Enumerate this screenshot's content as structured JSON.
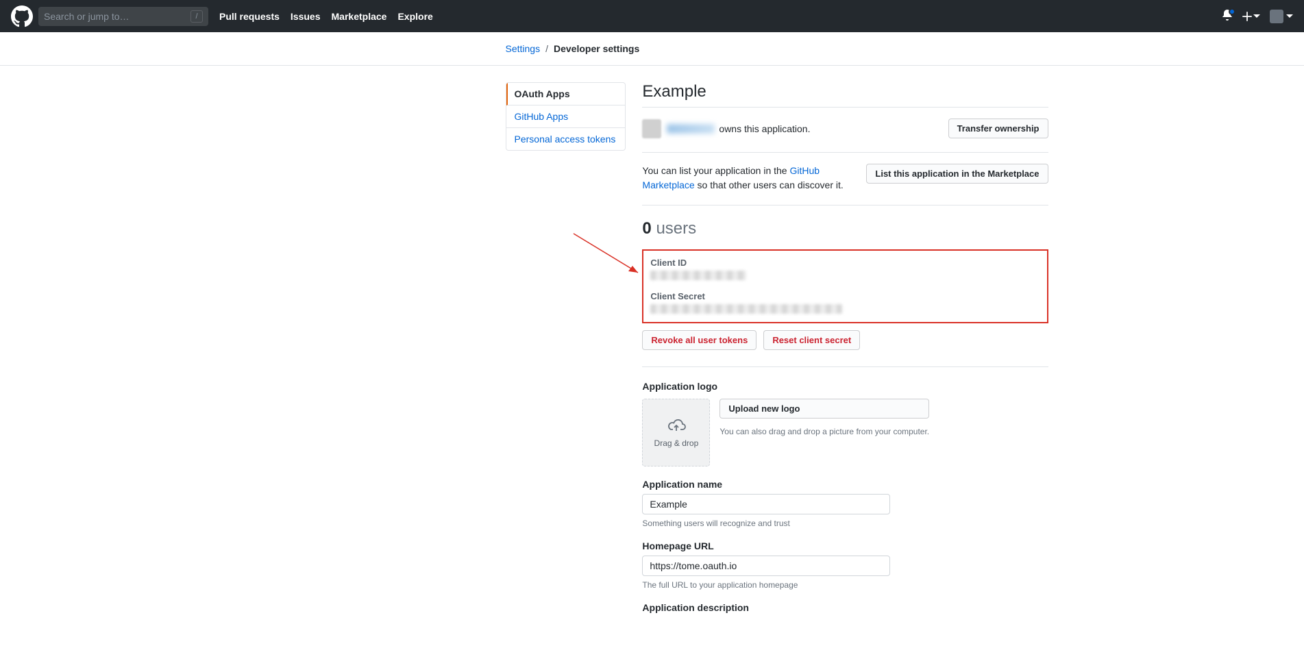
{
  "header": {
    "search_placeholder": "Search or jump to…",
    "slash_key": "/",
    "nav": {
      "pull_requests": "Pull requests",
      "issues": "Issues",
      "marketplace": "Marketplace",
      "explore": "Explore"
    }
  },
  "breadcrumb": {
    "settings": "Settings",
    "sep": "/",
    "current": "Developer settings"
  },
  "sidebar": {
    "items": [
      {
        "label": "OAuth Apps"
      },
      {
        "label": "GitHub Apps"
      },
      {
        "label": "Personal access tokens"
      }
    ]
  },
  "content": {
    "title": "Example",
    "owner_suffix": "owns this application.",
    "transfer_btn": "Transfer ownership",
    "marketplace_prefix": "You can list your application in the ",
    "marketplace_link": "GitHub Marketplace",
    "marketplace_suffix": " so that other users can discover it.",
    "list_btn": "List this application in the Marketplace",
    "user_count": "0",
    "user_label": "users",
    "client_id_label": "Client ID",
    "client_secret_label": "Client Secret",
    "revoke_btn": "Revoke all user tokens",
    "reset_btn": "Reset client secret",
    "app_logo_label": "Application logo",
    "drag_drop": "Drag & drop",
    "upload_btn": "Upload new logo",
    "upload_hint": "You can also drag and drop a picture from your computer.",
    "app_name_label": "Application name",
    "app_name_value": "Example",
    "app_name_help": "Something users will recognize and trust",
    "homepage_label": "Homepage URL",
    "homepage_value": "https://tome.oauth.io",
    "homepage_help": "The full URL to your application homepage",
    "app_desc_label": "Application description"
  }
}
